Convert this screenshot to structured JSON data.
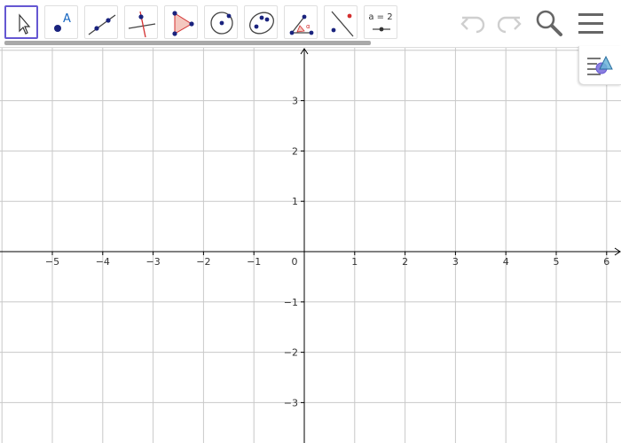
{
  "toolbar": {
    "tools": [
      {
        "name": "move-tool",
        "icon": "arrow-pointer-icon",
        "selected": true
      },
      {
        "name": "point-tool",
        "icon": "point-icon",
        "label": "A"
      },
      {
        "name": "line-tool",
        "icon": "line-through-points-icon"
      },
      {
        "name": "perpendicular-line-tool",
        "icon": "perpendicular-line-icon"
      },
      {
        "name": "polygon-tool",
        "icon": "polygon-icon"
      },
      {
        "name": "circle-tool",
        "icon": "circle-center-point-icon"
      },
      {
        "name": "conic-tool",
        "icon": "ellipse-icon"
      },
      {
        "name": "angle-tool",
        "icon": "angle-icon",
        "label": "α"
      },
      {
        "name": "reflect-tool",
        "icon": "reflect-about-line-icon"
      },
      {
        "name": "slider-tool",
        "icon": "slider-icon",
        "label": "a = 2"
      }
    ],
    "undo_icon": "undo-icon",
    "redo_icon": "redo-icon",
    "search_icon": "search-icon",
    "menu_icon": "hamburger-menu-icon"
  },
  "style_bar_toggle": {
    "icon": "style-bar-icon"
  },
  "graphics": {
    "x_ticks": [
      "−5",
      "−4",
      "−3",
      "−2",
      "−1",
      "0",
      "1",
      "2",
      "3",
      "4",
      "5",
      "6"
    ],
    "y_ticks_pos": [
      "1",
      "2",
      "3"
    ],
    "y_ticks_neg": [
      "−1",
      "−2",
      "−3"
    ],
    "grid": true
  },
  "colors": {
    "accent": "#6557d2",
    "point": "#1565c0",
    "point_dark": "#1a237e",
    "highlight_red": "#d32f2f",
    "polygon_fill": "#f4c7bf",
    "grid": "#c8c8c8",
    "axis": "#000000"
  }
}
